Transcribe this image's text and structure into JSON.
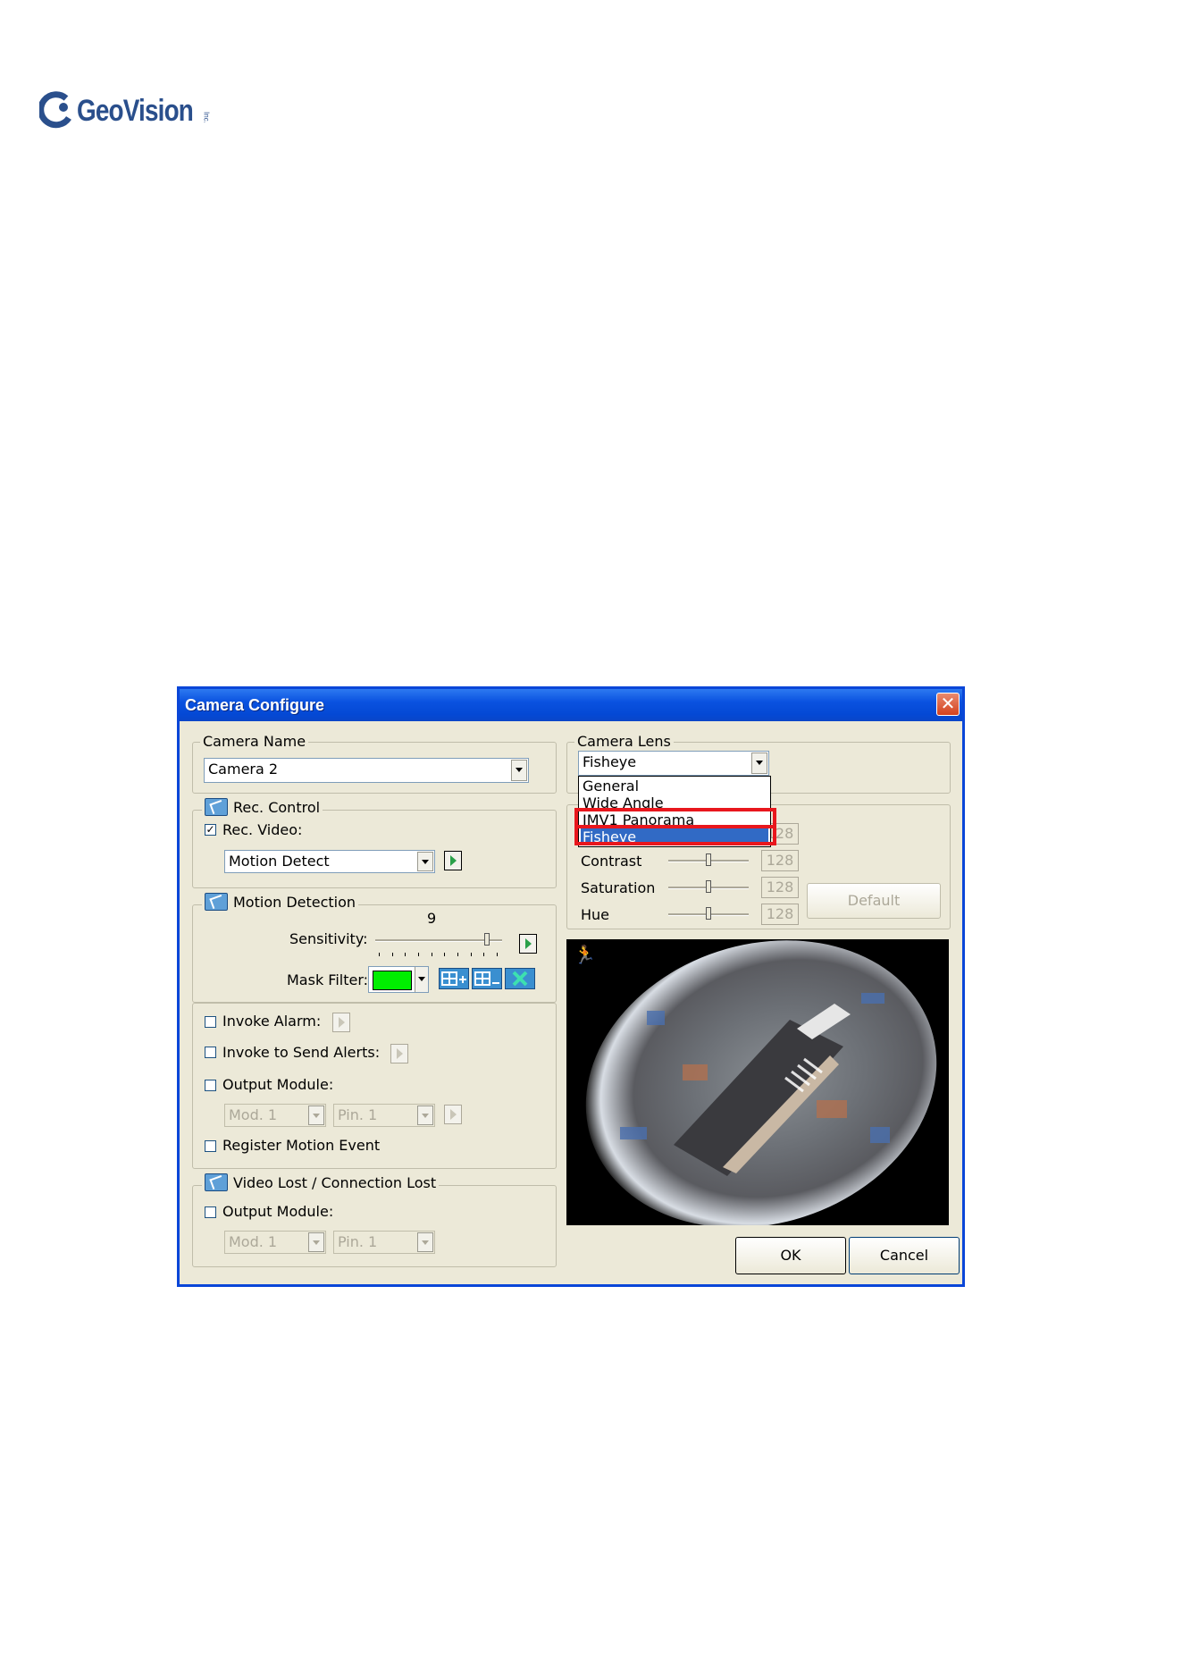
{
  "logo": {
    "text": "GeoVision",
    "suffix": "Inc.",
    "color": "#2a4f8c"
  },
  "window": {
    "title": "Camera Configure",
    "close_glyph": "✕",
    "camera_name": {
      "legend": "Camera Name",
      "value": "Camera 2"
    },
    "rec_control": {
      "legend": "Rec. Control",
      "rec_video_label": "Rec. Video:",
      "rec_video_checked": true,
      "mode_value": "Motion Detect"
    },
    "motion_detection": {
      "legend": "Motion Detection",
      "sensitivity_label": "Sensitivity:",
      "sensitivity_value": "9",
      "sensitivity_level": 0.9,
      "mask_filter_label": "Mask Filter:",
      "mask_color": "#00ee00"
    },
    "events": {
      "invoke_alarm": "Invoke Alarm:",
      "invoke_alerts": "Invoke to Send Alerts:",
      "output_module": "Output Module:",
      "module_value": "Mod. 1",
      "pin_value": "Pin. 1",
      "register_motion": "Register Motion Event"
    },
    "video_lost": {
      "legend": "Video Lost / Connection Lost",
      "output_module": "Output Module:",
      "module_value": "Mod. 1",
      "pin_value": "Pin. 1"
    },
    "camera_lens": {
      "legend": "Camera Lens",
      "value": "Fisheye",
      "options": [
        "General",
        "Wide Angle",
        "IMV1 Panorama",
        "Fisheye"
      ],
      "selected_index": 3,
      "highlighted": [
        "IMV1 Panorama",
        "Fisheye"
      ]
    },
    "image_adjust": {
      "rows": [
        {
          "label": "",
          "value": "128",
          "level": 0.5
        },
        {
          "label": "Contrast",
          "value": "128",
          "level": 0.5
        },
        {
          "label": "Saturation",
          "value": "128",
          "level": 0.5
        },
        {
          "label": "Hue",
          "value": "128",
          "level": 0.5
        }
      ],
      "default_button": "Default"
    },
    "buttons": {
      "ok": "OK",
      "cancel": "Cancel"
    },
    "accent_color": "#0a46d8",
    "highlight_color": "#e8171d"
  }
}
